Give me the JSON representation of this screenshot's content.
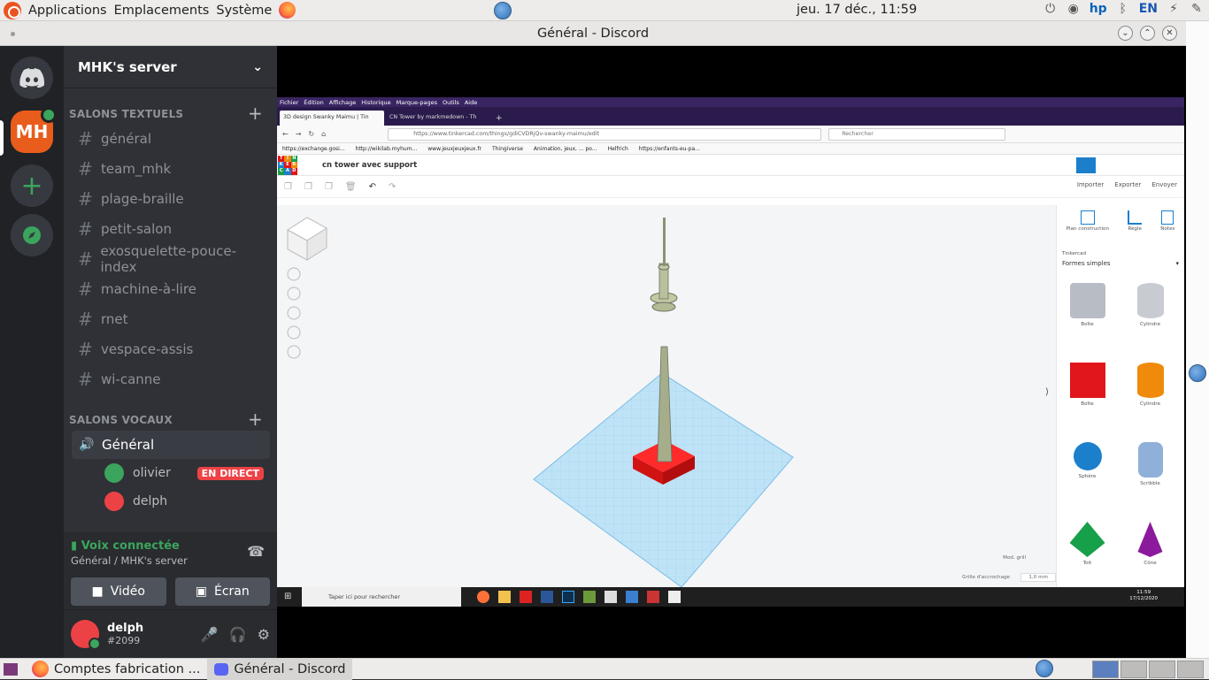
{
  "topbar": {
    "menus": [
      "Applications",
      "Emplacements",
      "Système"
    ],
    "clock": "jeu. 17 déc., 11:59",
    "lang": "EN"
  },
  "window": {
    "title": "Général - Discord"
  },
  "server": {
    "name": "MHK's server",
    "text_category": "SALONS TEXTUELS",
    "text_channels": [
      "général",
      "team_mhk",
      "plage-braille",
      "petit-salon",
      "exosquelette-pouce-index",
      "machine-à-lire",
      "rnet",
      "vespace-assis",
      "wi-canne"
    ],
    "voice_category": "SALONS VOCAUX",
    "voice_channel": "Général",
    "voice_users": [
      {
        "name": "olivier",
        "badge": "EN DIRECT",
        "color": "#3ba55d"
      },
      {
        "name": "delph",
        "badge": "",
        "color": "#ed4245"
      }
    ]
  },
  "voice_panel": {
    "status": "Voix connectée",
    "location": "Général / MHK's server",
    "video_label": "Vidéo",
    "screen_label": "Écran"
  },
  "user": {
    "name": "delph",
    "tag": "#2099"
  },
  "stream": {
    "ff_menu": [
      "Fichier",
      "Édition",
      "Affichage",
      "Historique",
      "Marque-pages",
      "Outils",
      "Aide"
    ],
    "tabs": [
      "3D design Swanky Maimu | Tin",
      "CN Tower by markmedown - Th"
    ],
    "url": "https://www.tinkercad.com/things/gdiCVDRjQv-swanky-maimu/edit",
    "search_placeholder": "Rechercher",
    "bookmarks": [
      "https://exchange.gosi...",
      "http://wikilab.myhum...",
      "www.jeuxjeuxjeux.fr",
      "Thingiverse",
      "Animation, jeux, ... po...",
      "Helfrich",
      "https://enfants-eu-pa..."
    ],
    "logo_letters": [
      "T",
      "I",
      "N",
      "K",
      "E",
      "R",
      "C",
      "A",
      "D"
    ],
    "design_title": "cn tower avec support",
    "actions": [
      "Importer",
      "Exporter",
      "Envoyer"
    ],
    "panel_tools": [
      "Plan construction",
      "Règle",
      "Notes"
    ],
    "library_label": "Tinkercad",
    "library_value": "Formes simples",
    "shapes": [
      {
        "name": "Boîte",
        "color": "#b8bcc4"
      },
      {
        "name": "Cylindre",
        "color": "#c8ccd2"
      },
      {
        "name": "Boîte",
        "color": "#e0161b"
      },
      {
        "name": "Cylindre",
        "color": "#f08a0b"
      },
      {
        "name": "Sphère",
        "color": "#1b7fcc"
      },
      {
        "name": "Scribble",
        "color": "#8fb0d8"
      },
      {
        "name": "Toit",
        "color": "#17a04a"
      },
      {
        "name": "Cône",
        "color": "#8c1a9c"
      }
    ],
    "mod_grid": "Mod. grill",
    "snap_label": "Grille d'accrochage",
    "snap_value": "1,0 mm",
    "win_search": "Taper ici pour rechercher",
    "win_time": "11:59",
    "win_date": "17/12/2020"
  },
  "taskbar": {
    "items": [
      "Comptes fabrication ...",
      "Général - Discord"
    ]
  }
}
